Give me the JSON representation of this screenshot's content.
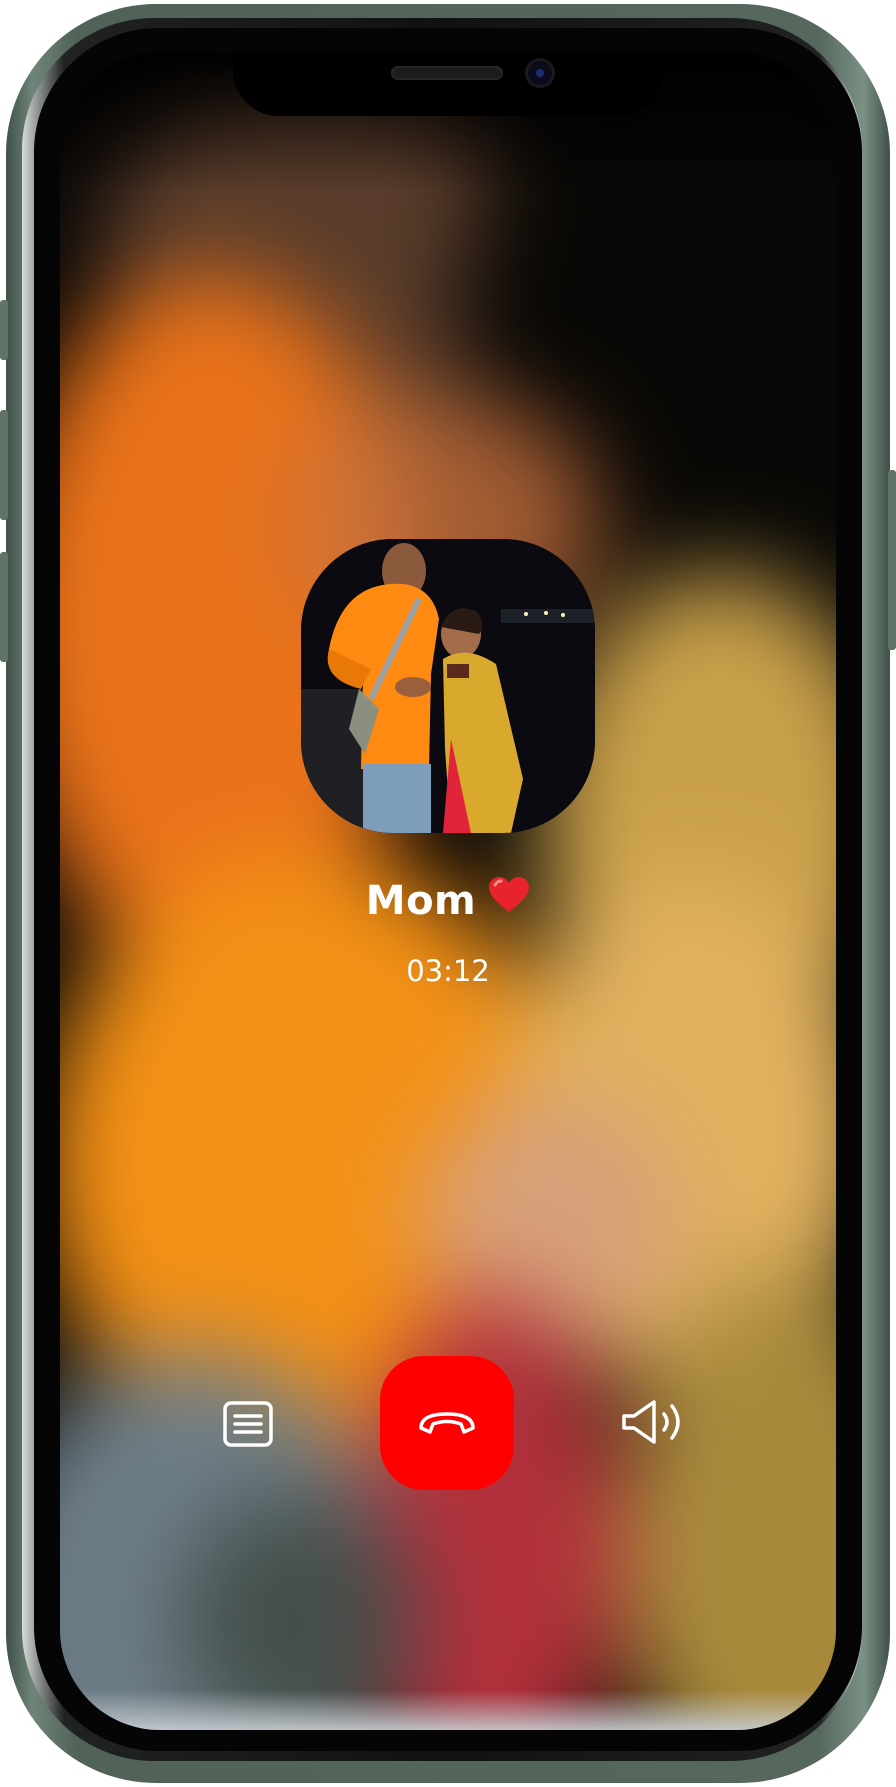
{
  "call": {
    "caller_name": "Mom",
    "caller_emoji": "heart-icon",
    "duration": "03:12"
  },
  "controls": {
    "notes_icon": "notes-icon",
    "end_call_icon": "phone-hangup-icon",
    "speaker_icon": "speaker-icon",
    "end_call_color": "#ff0000"
  },
  "device": {
    "frame_color": "#56685e",
    "accent_heart": "#e8232b"
  }
}
